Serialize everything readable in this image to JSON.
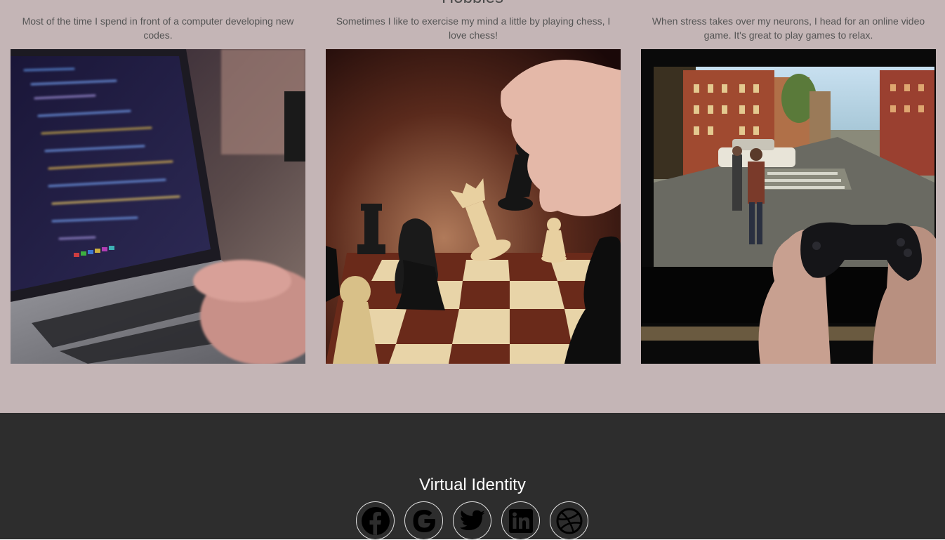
{
  "hobbies": {
    "title": "Hobbies",
    "cards": [
      {
        "description": "Most of the time I spend in front of a computer developing new codes.",
        "image": "laptop-coding-photo"
      },
      {
        "description": "Sometimes I like to exercise my mind a little by playing chess, I love chess!",
        "image": "chess-game-photo"
      },
      {
        "description": "When stress takes over my neurons, I head for an online video game. It's great to play games to relax.",
        "image": "video-game-photo"
      }
    ]
  },
  "footer": {
    "title": "Virtual Identity",
    "social": [
      {
        "name": "facebook",
        "icon": "facebook-icon"
      },
      {
        "name": "google",
        "icon": "google-icon"
      },
      {
        "name": "twitter",
        "icon": "twitter-icon"
      },
      {
        "name": "linkedin",
        "icon": "linkedin-icon"
      },
      {
        "name": "dribbble",
        "icon": "dribbble-icon"
      }
    ]
  },
  "colors": {
    "section_bg": "#c4b5b6",
    "footer_bg": "#2d2d2d"
  }
}
